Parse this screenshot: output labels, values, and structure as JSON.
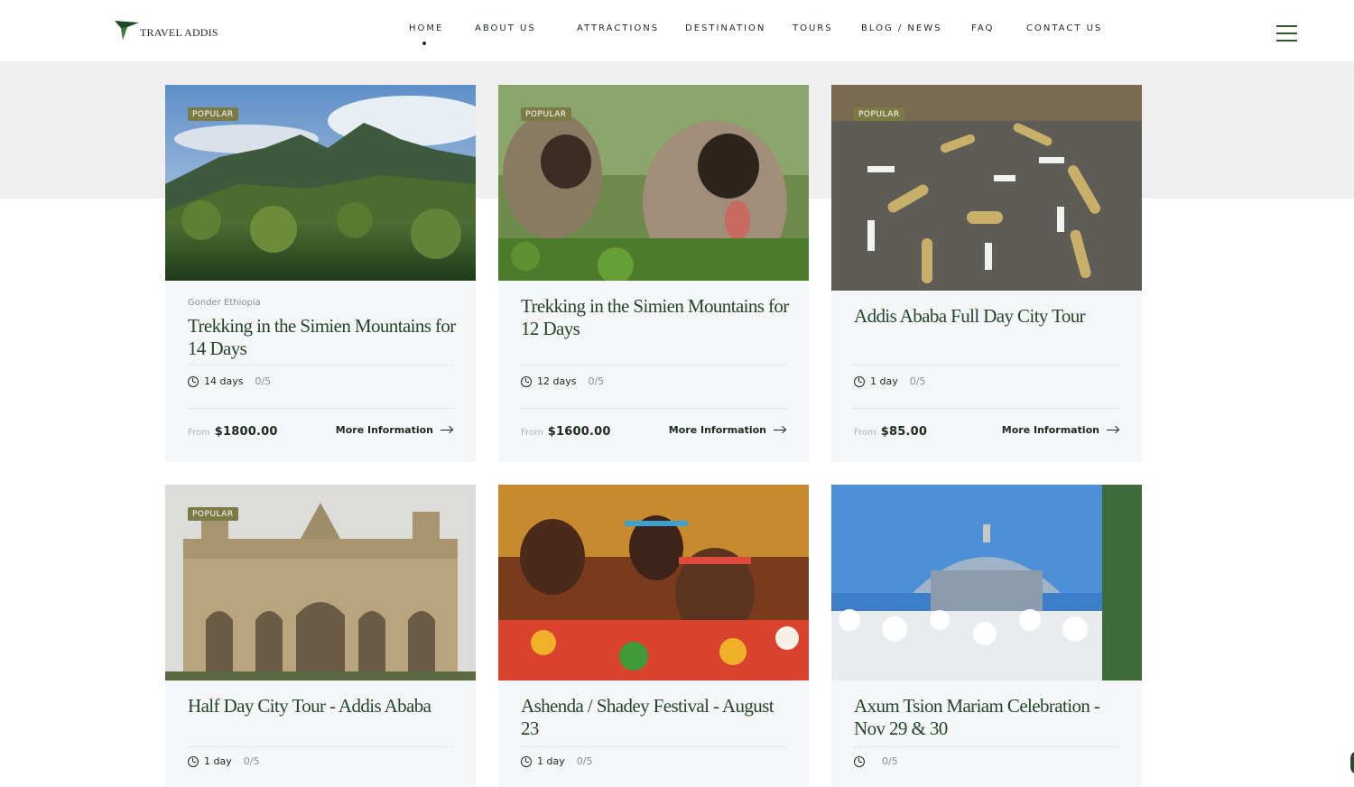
{
  "brand": {
    "name": "TRAVEL ADDIS",
    "accent": "#24452a",
    "badge_color": "#7c7a45"
  },
  "nav": {
    "items": [
      "HOME",
      "ABOUT US",
      "ATTRACTIONS",
      "DESTINATION",
      "TOURS",
      "BLOG / NEWS",
      "FAQ",
      "CONTACT US"
    ],
    "active": "HOME",
    "menu_icon": "hamburger-menu-icon"
  },
  "cards": [
    {
      "badge": "POPULAR",
      "location": "Gonder Ethiopia",
      "title": "Trekking in the Simien Mountains for 14 Days",
      "duration": "14 days",
      "rating": "0/5",
      "from_label": "From",
      "price": "$1800.00",
      "more_label": "More Information",
      "image": "mountain-forest-photo"
    },
    {
      "badge": "POPULAR",
      "location": "",
      "title": "Trekking in the Simien Mountains for 12 Days",
      "duration": "12 days",
      "rating": "0/5",
      "from_label": "From",
      "price": "$1600.00",
      "more_label": "More Information",
      "image": "gelada-monkeys-photo"
    },
    {
      "badge": "POPULAR",
      "location": "",
      "title": "Addis Ababa Full Day City Tour",
      "duration": "1 day",
      "rating": "0/5",
      "from_label": "From",
      "price": "$85.00",
      "more_label": "More Information",
      "image": "fossil-bones-photo"
    },
    {
      "badge": "POPULAR",
      "location": "",
      "title": "Half Day City Tour - Addis Ababa",
      "duration": "1 day",
      "rating": "0/5",
      "image": "cathedral-photo"
    },
    {
      "badge": "",
      "location": "",
      "title": "Ashenda / Shadey Festival - August 23",
      "duration": "1 day",
      "rating": "0/5",
      "image": "festival-girls-photo"
    },
    {
      "badge": "",
      "location": "",
      "title": "Axum Tsion Mariam Celebration - Nov 29 & 30",
      "duration": "",
      "rating": "0/5",
      "image": "church-crowd-photo"
    }
  ]
}
